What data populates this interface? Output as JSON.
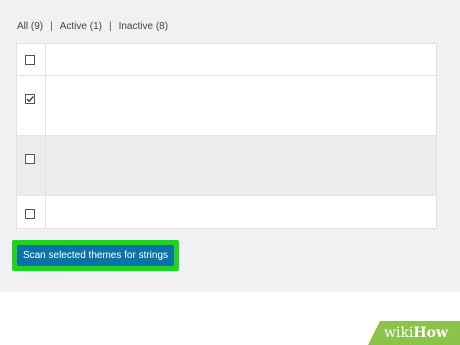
{
  "filters": {
    "all": "All (9)",
    "separator_1": "|",
    "active": "Active (1)",
    "separator_2": "|",
    "inactive": "Inactive (8)"
  },
  "themes_table": {
    "rows": [
      {
        "checked": false
      },
      {
        "checked": true
      },
      {
        "checked": false
      },
      {
        "checked": false
      }
    ]
  },
  "actions": {
    "scan_button_label": "Scan selected themes for strings"
  },
  "colors": {
    "button_background": "#0a72a8",
    "highlight": "#21d321",
    "watermark": "#8bc34a"
  },
  "watermark": {
    "prefix": "wiki",
    "suffix": "How"
  }
}
